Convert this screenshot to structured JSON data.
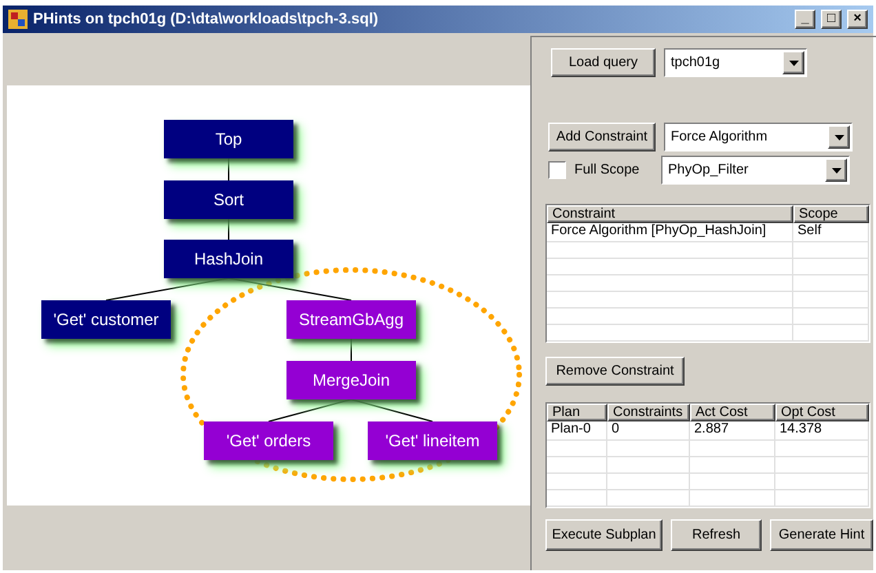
{
  "window": {
    "title": "PHints on tpch01g (D:\\dta\\workloads\\tpch-3.sql)",
    "buttons": [
      "_",
      "□",
      "×"
    ]
  },
  "plan_tree": {
    "label": "Top",
    "selected": false,
    "children": [
      {
        "label": "Sort",
        "selected": false,
        "children": [
          {
            "label": "HashJoin",
            "selected": false,
            "children": [
              {
                "label": "'Get' customer",
                "selected": false
              },
              {
                "label": "StreamGbAgg",
                "selected": true,
                "children": [
                  {
                    "label": "MergeJoin",
                    "selected": true,
                    "children": [
                      {
                        "label": "'Get' orders",
                        "selected": true
                      },
                      {
                        "label": "'Get' lineitem",
                        "selected": true
                      }
                    ]
                  }
                ]
              }
            ]
          }
        ]
      }
    ]
  },
  "load_query": {
    "button": "Load query",
    "value": "tpch01g"
  },
  "add_constraint": {
    "button": "Add Constraint",
    "value": "Force Algorithm"
  },
  "full_scope": {
    "label": "Full Scope",
    "checked": false,
    "value": "PhyOp_Filter"
  },
  "constraints_table": {
    "columns": [
      "Constraint",
      "Scope"
    ],
    "rows": [
      [
        "Force Algorithm [PhyOp_HashJoin]",
        "Self"
      ]
    ]
  },
  "remove_button": "Remove Constraint",
  "plans_table": {
    "columns": [
      "Plan",
      "Constraints",
      "Act Cost",
      "Opt Cost"
    ],
    "rows": [
      [
        "Plan-0",
        "0",
        "2.887",
        "14.378"
      ]
    ]
  },
  "bottom_buttons": [
    "Execute Subplan",
    "Refresh",
    "Generate Hint"
  ]
}
